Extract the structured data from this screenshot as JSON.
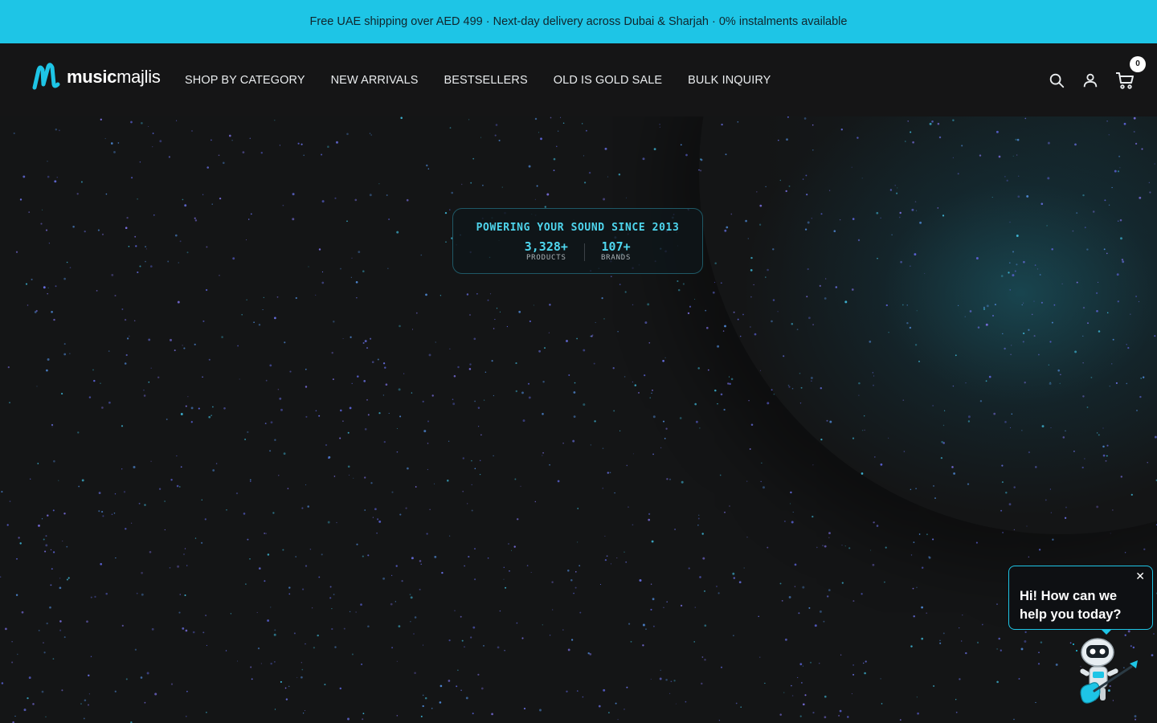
{
  "announcement": {
    "text": "Free UAE shipping over AED 499 · Next-day delivery across Dubai & Sharjah · 0% instalments available"
  },
  "header": {
    "logo": {
      "word_bold": "music",
      "word_light": "majlis",
      "icon": "musicmajlis-logo-icon"
    },
    "nav": [
      {
        "label": "SHOP BY CATEGORY"
      },
      {
        "label": "NEW ARRIVALS"
      },
      {
        "label": "BESTSELLERS"
      },
      {
        "label": "OLD IS GOLD SALE"
      },
      {
        "label": "BULK INQUIRY"
      }
    ],
    "icons": [
      "search-icon",
      "account-icon",
      "cart-icon"
    ],
    "cart_count": "0"
  },
  "hero": {
    "stat_card": {
      "title": "POWERING YOUR SOUND SINCE 2013",
      "stats": [
        {
          "value": "3,328+",
          "label": "PRODUCTS"
        },
        {
          "value": "107+",
          "label": "BRANDS"
        }
      ]
    }
  },
  "chat": {
    "message": "Hi! How can we help you today?",
    "close_icon": "close-icon",
    "avatar_icon": "robot-guitar-icon"
  },
  "colors": {
    "accent": "#1ec5e6",
    "background": "#141516",
    "stat_text": "#4fd6ee"
  }
}
